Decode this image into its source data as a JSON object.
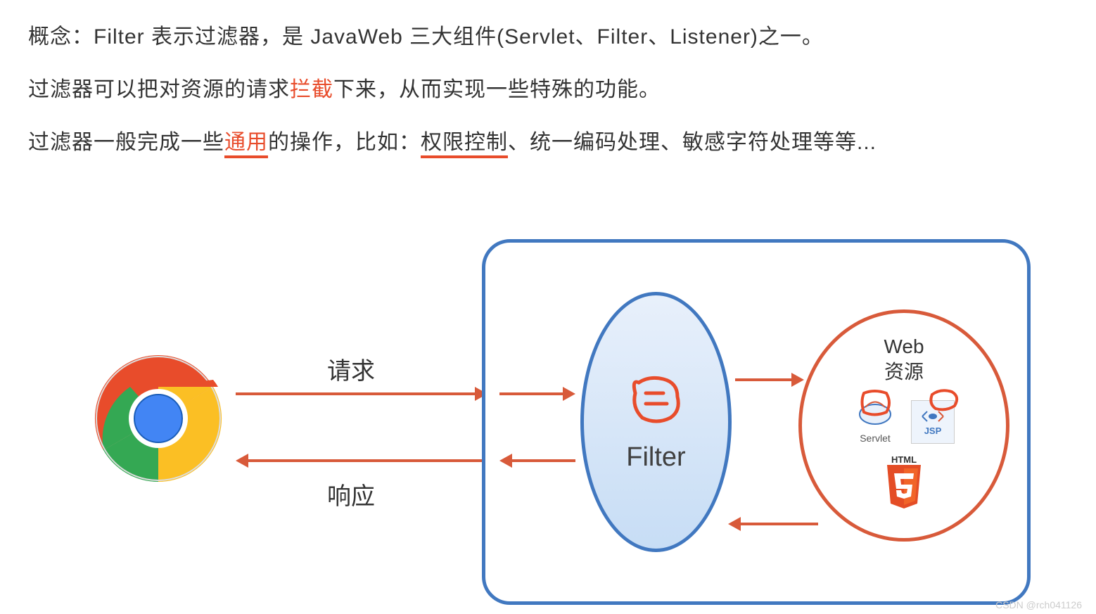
{
  "text": {
    "line1_pre": "概念：Filter 表示过滤器，是 JavaWeb 三大组件(Servlet、Filter、Listener)之一。",
    "line2_pre": "过滤器可以把对资源的请求",
    "line2_hl": "拦截",
    "line2_post": "下来，从而实现一些特殊的功能。",
    "line3_pre": "过滤器一般完成一些",
    "line3_hl1": "通用",
    "line3_mid": "的操作，比如：",
    "line3_hl2": "权限控制",
    "line3_post": "、统一编码处理、敏感字符处理等等..."
  },
  "diagram": {
    "arrow_request": "请求",
    "arrow_response": "响应",
    "filter_label": "Filter",
    "web_title_line1": "Web",
    "web_title_line2": "资源",
    "servlet_label": "Servlet",
    "jsp_label": "JSP",
    "html_label": "HTML"
  },
  "watermark": "CSDN @rch041126"
}
